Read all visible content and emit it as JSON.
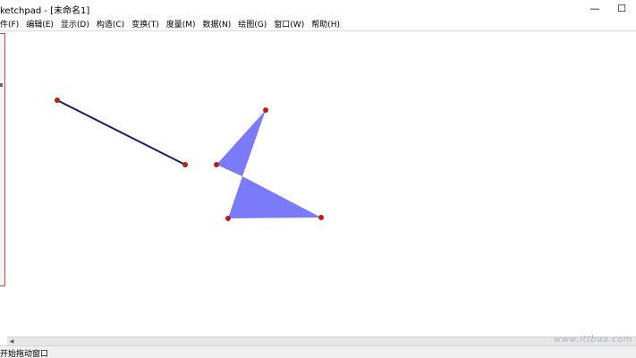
{
  "window": {
    "title": "ketchpad  - [未命名1]",
    "minimize_glyph": "—",
    "maximize_glyph": "☐"
  },
  "menubar": {
    "items": [
      {
        "label": "件(F)"
      },
      {
        "label": "编辑(E)"
      },
      {
        "label": "显示(D)"
      },
      {
        "label": "构造(C)"
      },
      {
        "label": "变换(T)"
      },
      {
        "label": "度量(M)"
      },
      {
        "label": "数据(N)"
      },
      {
        "label": "绘图(G)"
      },
      {
        "label": "窗口(W)"
      },
      {
        "label": "帮助(H)"
      }
    ]
  },
  "canvas": {
    "segment_color": "#1c1c6b",
    "polygon_fill": "#7b7bfa",
    "point_color": "#b51f1f"
  },
  "statusbar": {
    "text": "开始拖动窗口"
  },
  "watermark": {
    "text": "www.ittbaa.com"
  }
}
